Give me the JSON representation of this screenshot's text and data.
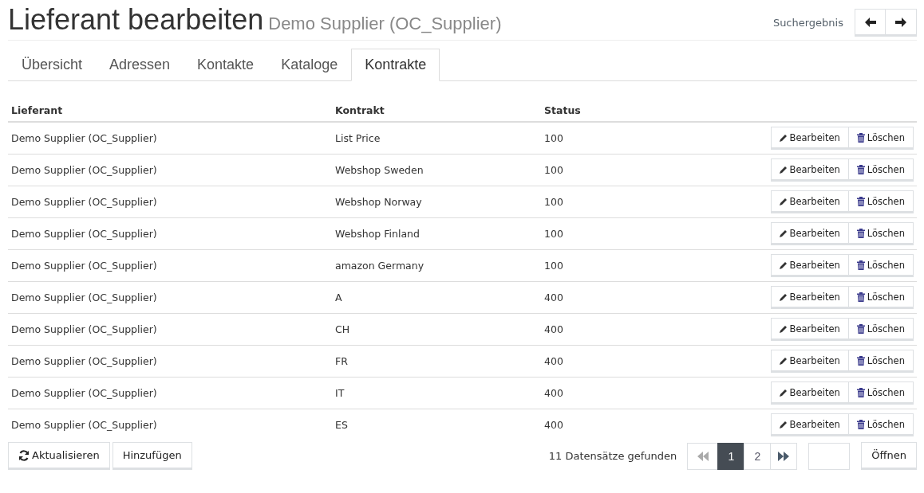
{
  "header": {
    "title": "Lieferant bearbeiten",
    "subtitle": "Demo Supplier (OC_Supplier)",
    "search_result_label": "Suchergebnis"
  },
  "tabs": [
    {
      "label": "Übersicht",
      "selected": false
    },
    {
      "label": "Adressen",
      "selected": false
    },
    {
      "label": "Kontakte",
      "selected": false
    },
    {
      "label": "Kataloge",
      "selected": false
    },
    {
      "label": "Kontrakte",
      "selected": true
    }
  ],
  "table": {
    "columns": [
      "Lieferant",
      "Kontrakt",
      "Status"
    ],
    "rows": [
      {
        "supplier": "Demo Supplier (OC_Supplier)",
        "contract": "List Price",
        "status": "100",
        "edit": "Bearbeiten",
        "delete": "Löschen"
      },
      {
        "supplier": "Demo Supplier (OC_Supplier)",
        "contract": "Webshop Sweden",
        "status": "100",
        "edit": "Bearbeiten",
        "delete": "Löschen"
      },
      {
        "supplier": "Demo Supplier (OC_Supplier)",
        "contract": "Webshop Norway",
        "status": "100",
        "edit": "Bearbeiten",
        "delete": "Löschen"
      },
      {
        "supplier": "Demo Supplier (OC_Supplier)",
        "contract": "Webshop Finland",
        "status": "100",
        "edit": "Bearbeiten",
        "delete": "Löschen"
      },
      {
        "supplier": "Demo Supplier (OC_Supplier)",
        "contract": "amazon Germany",
        "status": "100",
        "edit": "Bearbeiten",
        "delete": "Löschen"
      },
      {
        "supplier": "Demo Supplier (OC_Supplier)",
        "contract": "A",
        "status": "400",
        "edit": "Bearbeiten",
        "delete": "Löschen"
      },
      {
        "supplier": "Demo Supplier (OC_Supplier)",
        "contract": "CH",
        "status": "400",
        "edit": "Bearbeiten",
        "delete": "Löschen"
      },
      {
        "supplier": "Demo Supplier (OC_Supplier)",
        "contract": "FR",
        "status": "400",
        "edit": "Bearbeiten",
        "delete": "Löschen"
      },
      {
        "supplier": "Demo Supplier (OC_Supplier)",
        "contract": "IT",
        "status": "400",
        "edit": "Bearbeiten",
        "delete": "Löschen"
      },
      {
        "supplier": "Demo Supplier (OC_Supplier)",
        "contract": "ES",
        "status": "400",
        "edit": "Bearbeiten",
        "delete": "Löschen"
      }
    ]
  },
  "footer": {
    "refresh": "Aktualisieren",
    "add": "Hinzufügen",
    "record_count": "11 Datensätze gefunden",
    "pagination": {
      "first_disabled": true,
      "last_disabled": false,
      "pages": [
        {
          "label": "1",
          "selected": true
        },
        {
          "label": "2",
          "selected": false
        }
      ]
    },
    "open": "Öffnen"
  }
}
